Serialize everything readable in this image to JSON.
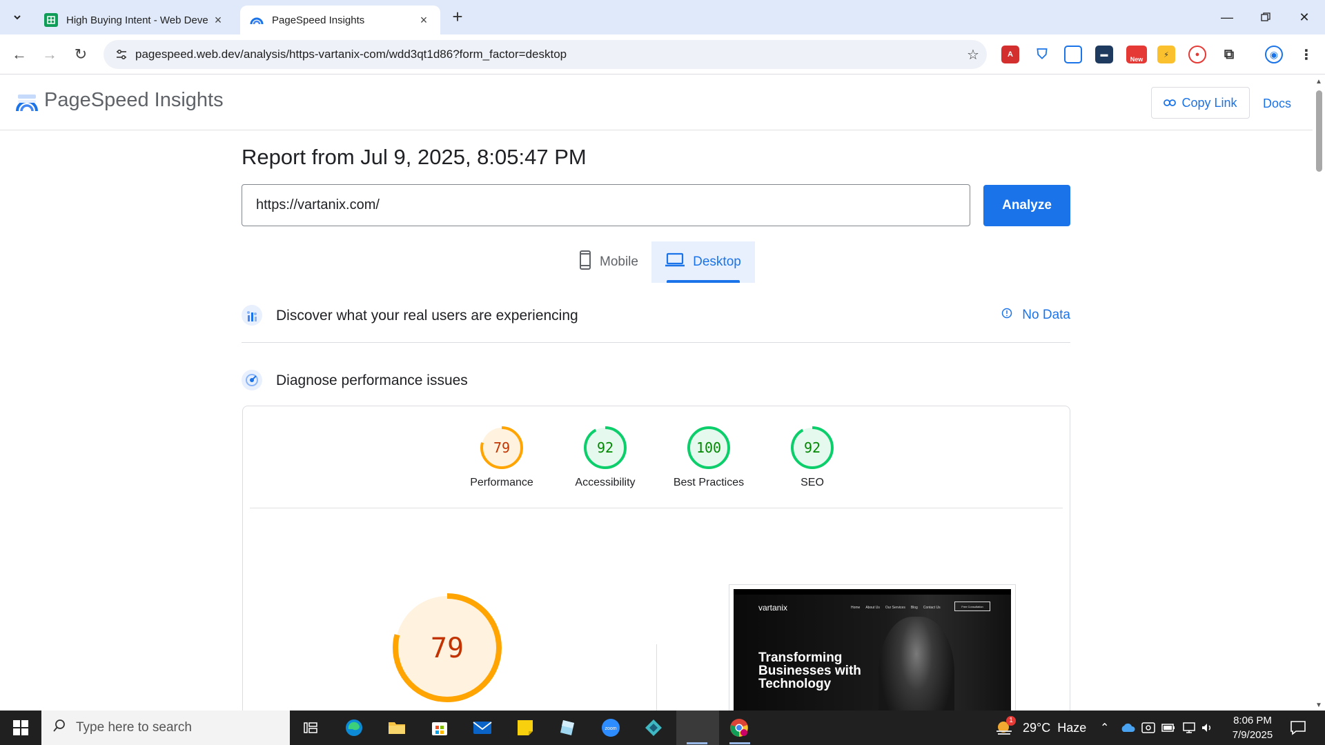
{
  "browser": {
    "tabs": [
      {
        "title": "High Buying Intent - Web Deve",
        "favicon": "sheets-icon",
        "active": false
      },
      {
        "title": "PageSpeed Insights",
        "favicon": "pagespeed-icon",
        "active": true
      }
    ],
    "url": "pagespeed.web.dev/analysis/https-vartanix-com/wdd3qt1d86?form_factor=desktop",
    "extension_badge": "New"
  },
  "header": {
    "app_title": "PageSpeed Insights",
    "copy_link": "Copy Link",
    "docs": "Docs"
  },
  "report": {
    "title": "Report from Jul 9, 2025, 8:05:47 PM",
    "url_value": "https://vartanix.com/",
    "analyze_label": "Analyze",
    "device_tabs": [
      {
        "label": "Mobile",
        "selected": false
      },
      {
        "label": "Desktop",
        "selected": true
      }
    ],
    "field_section": {
      "title": "Discover what your real users are experiencing",
      "status": "No Data"
    },
    "diagnose_section": {
      "title": "Diagnose performance issues"
    },
    "scores": [
      {
        "label": "Performance",
        "value": 79,
        "color": "#ffa400"
      },
      {
        "label": "Accessibility",
        "value": 92,
        "color": "#0cce6b"
      },
      {
        "label": "Best Practices",
        "value": 100,
        "color": "#0cce6b"
      },
      {
        "label": "SEO",
        "value": 92,
        "color": "#0cce6b"
      }
    ],
    "main_score": {
      "value": 79,
      "color": "#ffa400"
    },
    "screenshot": {
      "logo": "vartanix",
      "nav": [
        "Home",
        "About Us",
        "Our Services",
        "Blog",
        "Contact Us"
      ],
      "cta": "Free Consultation",
      "headline": "Transforming Businesses with Technology"
    }
  },
  "taskbar": {
    "search_placeholder": "Type here to search",
    "weather": "29°C  Haze",
    "weather_badge": "1",
    "time": "8:06 PM",
    "date": "7/9/2025"
  },
  "colors": {
    "accent": "#1a73e8",
    "average": "#ffa400",
    "pass": "#0cce6b"
  }
}
